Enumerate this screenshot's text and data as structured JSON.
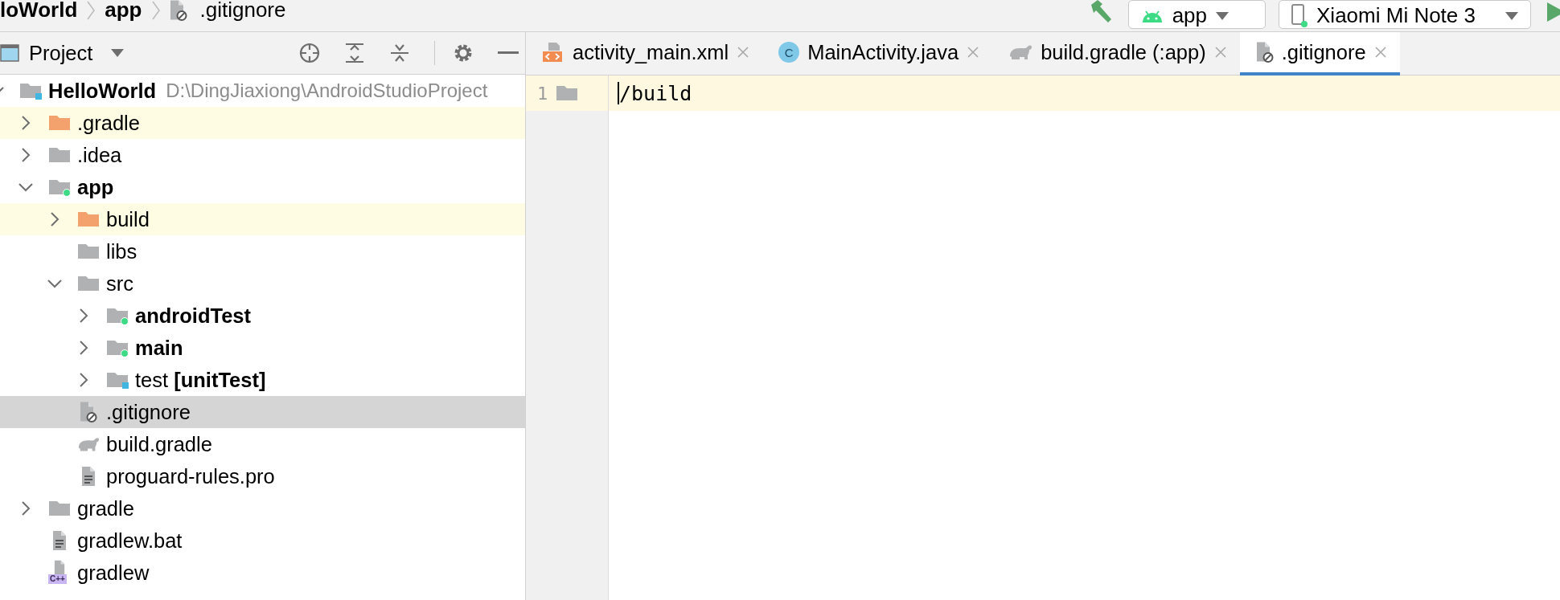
{
  "breadcrumb": [
    {
      "label": "loWorld",
      "bold": true,
      "kind": "folder"
    },
    {
      "label": "app",
      "bold": true,
      "kind": "folder"
    },
    {
      "label": ".gitignore",
      "bold": false,
      "kind": "ignore"
    }
  ],
  "toolbar": {
    "run_config": "app",
    "device": "Xiaomi Mi Note 3"
  },
  "project_panel": {
    "title": "Project",
    "tree": [
      {
        "name": "HelloWorld",
        "detail": "D:\\DingJiaxiong\\AndroidStudioProject",
        "kind": "module",
        "bold": true,
        "expanded": true,
        "highlighted": false,
        "selected": false,
        "children": [
          {
            "name": ".gradle",
            "kind": "excluded",
            "bold": false,
            "expanded": false,
            "highlighted": true,
            "selected": false
          },
          {
            "name": ".idea",
            "kind": "folder",
            "bold": false,
            "expanded": false,
            "highlighted": false,
            "selected": false
          },
          {
            "name": "app",
            "kind": "source",
            "bold": true,
            "expanded": true,
            "highlighted": false,
            "selected": false,
            "children": [
              {
                "name": "build",
                "kind": "excluded",
                "bold": false,
                "expanded": false,
                "highlighted": true,
                "selected": false
              },
              {
                "name": "libs",
                "kind": "folder",
                "bold": false,
                "highlighted": false,
                "selected": false
              },
              {
                "name": "src",
                "kind": "folder",
                "bold": false,
                "expanded": true,
                "highlighted": false,
                "selected": false,
                "children": [
                  {
                    "name": "androidTest",
                    "kind": "source",
                    "bold": true,
                    "expanded": false,
                    "highlighted": false,
                    "selected": false
                  },
                  {
                    "name": "main",
                    "kind": "source",
                    "bold": true,
                    "expanded": false,
                    "highlighted": false,
                    "selected": false
                  },
                  {
                    "name": "test **[unitTest]**",
                    "kind": "test",
                    "bold": false,
                    "expanded": false,
                    "highlighted": false,
                    "selected": false
                  }
                ]
              },
              {
                "name": ".gitignore",
                "kind": "ignore",
                "bold": false,
                "highlighted": false,
                "selected": true
              },
              {
                "name": "build.gradle",
                "kind": "gradle",
                "bold": false,
                "highlighted": false,
                "selected": false
              },
              {
                "name": "proguard-rules.pro",
                "kind": "text",
                "bold": false,
                "highlighted": false,
                "selected": false
              }
            ]
          },
          {
            "name": "gradle",
            "kind": "folder",
            "bold": false,
            "expanded": false,
            "highlighted": false,
            "selected": false
          },
          {
            "name": "gradlew.bat",
            "kind": "text",
            "bold": false,
            "highlighted": false,
            "selected": false
          },
          {
            "name": "gradlew",
            "kind": "cpp",
            "badge": "C++",
            "bold": false,
            "highlighted": false,
            "selected": false
          }
        ]
      }
    ]
  },
  "tabs": [
    {
      "label": "activity_main.xml",
      "kind": "xml",
      "selected": false
    },
    {
      "label": "MainActivity.java",
      "kind": "java",
      "badge": "C",
      "selected": false
    },
    {
      "label": "build.gradle (:app)",
      "kind": "gradle",
      "selected": false
    },
    {
      "label": ".gitignore",
      "kind": "ignore",
      "selected": true
    }
  ],
  "editor": {
    "lines": [
      {
        "number": "1",
        "text": "/build",
        "current": true
      }
    ]
  }
}
